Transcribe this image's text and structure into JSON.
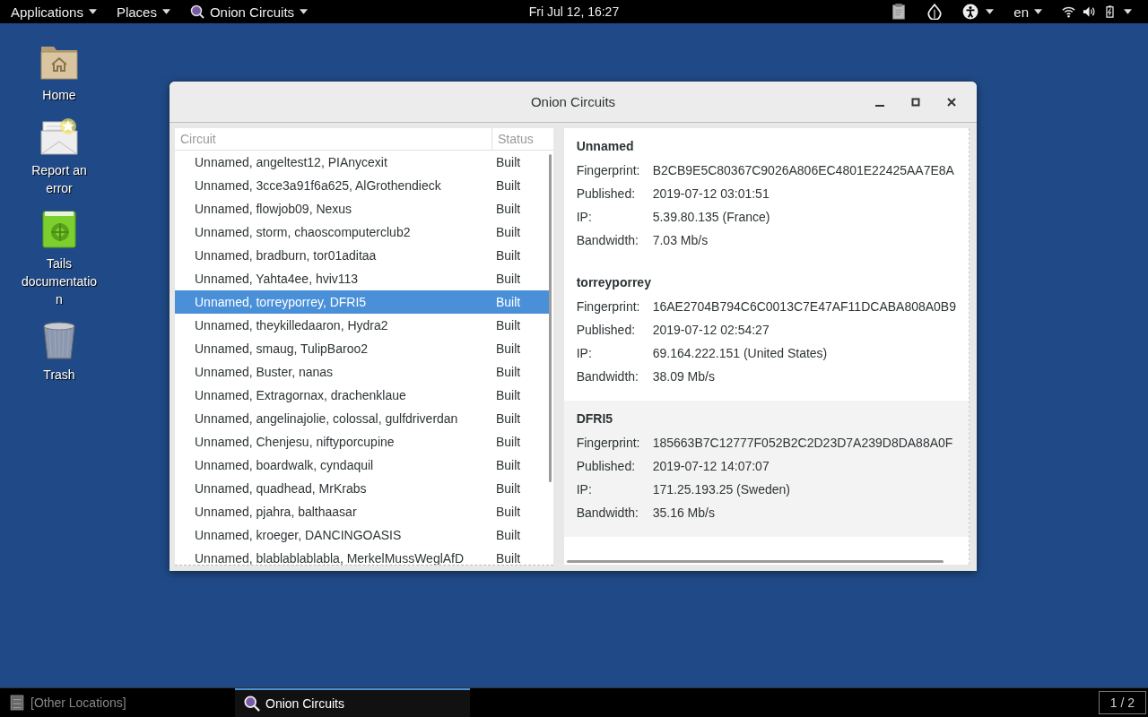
{
  "top_bar": {
    "menus": [
      {
        "label": "Applications",
        "kind": "menu"
      },
      {
        "label": "Places",
        "kind": "menu"
      },
      {
        "label": "Onion Circuits",
        "kind": "app"
      }
    ],
    "clock": "Fri Jul 12, 16:27",
    "language": "en"
  },
  "desktop_icons": [
    {
      "label": "Home",
      "kind": "home"
    },
    {
      "label": "Report an error",
      "kind": "mail"
    },
    {
      "label": "Tails documentation",
      "kind": "book"
    },
    {
      "label": "Trash",
      "kind": "trash"
    }
  ],
  "window": {
    "title": "Onion Circuits",
    "columns": [
      "Circuit",
      "Status"
    ],
    "rows": [
      {
        "circuit": "Unnamed, angeltest12, PIAnycexit",
        "status": "Built",
        "selected": false
      },
      {
        "circuit": "Unnamed, 3cce3a91f6a625, AlGrothendieck",
        "status": "Built",
        "selected": false
      },
      {
        "circuit": "Unnamed, flowjob09, Nexus",
        "status": "Built",
        "selected": false
      },
      {
        "circuit": "Unnamed, storm, chaoscomputerclub2",
        "status": "Built",
        "selected": false
      },
      {
        "circuit": "Unnamed, bradburn, tor01aditaa",
        "status": "Built",
        "selected": false
      },
      {
        "circuit": "Unnamed, Yahta4ee, hviv113",
        "status": "Built",
        "selected": false
      },
      {
        "circuit": "Unnamed, torreyporrey, DFRI5",
        "status": "Built",
        "selected": true
      },
      {
        "circuit": "Unnamed, theykilledaaron, Hydra2",
        "status": "Built",
        "selected": false
      },
      {
        "circuit": "Unnamed, smaug, TulipBaroo2",
        "status": "Built",
        "selected": false
      },
      {
        "circuit": "Unnamed, Buster, nanas",
        "status": "Built",
        "selected": false
      },
      {
        "circuit": "Unnamed, Extragornax, drachenklaue",
        "status": "Built",
        "selected": false
      },
      {
        "circuit": "Unnamed, angelinajolie, colossal, gulfdriverdan",
        "status": "Built",
        "selected": false
      },
      {
        "circuit": "Unnamed, Chenjesu, niftyporcupine",
        "status": "Built",
        "selected": false
      },
      {
        "circuit": "Unnamed, boardwalk, cyndaquil",
        "status": "Built",
        "selected": false
      },
      {
        "circuit": "Unnamed, quadhead, MrKrabs",
        "status": "Built",
        "selected": false
      },
      {
        "circuit": "Unnamed, pjahra, balthaasar",
        "status": "Built",
        "selected": false
      },
      {
        "circuit": "Unnamed, kroeger, DANCINGOASIS",
        "status": "Built",
        "selected": false
      },
      {
        "circuit": "Unnamed, blablablablabla, MerkelMussWeglAfD",
        "status": "Built",
        "selected": false
      }
    ],
    "nodes": [
      {
        "name": "Unnamed",
        "highlighted": false,
        "fields": [
          {
            "label": "Fingerprint:",
            "value": "B2CB9E5C80367C9026A806EC4801E22425AA7E8A"
          },
          {
            "label": "Published:",
            "value": "2019-07-12 03:01:51"
          },
          {
            "label": "IP:",
            "value": "5.39.80.135 (France)"
          },
          {
            "label": "Bandwidth:",
            "value": "7.03 Mb/s"
          }
        ]
      },
      {
        "name": "torreyporrey",
        "highlighted": false,
        "fields": [
          {
            "label": "Fingerprint:",
            "value": "16AE2704B794C6C0013C7E47AF11DCABA808A0B9"
          },
          {
            "label": "Published:",
            "value": "2019-07-12 02:54:27"
          },
          {
            "label": "IP:",
            "value": "69.164.222.151 (United States)"
          },
          {
            "label": "Bandwidth:",
            "value": "38.09 Mb/s"
          }
        ]
      },
      {
        "name": "DFRI5",
        "highlighted": true,
        "fields": [
          {
            "label": "Fingerprint:",
            "value": "185663B7C12777F052B2C2D23D7A239D8DA88A0F"
          },
          {
            "label": "Published:",
            "value": "2019-07-12 14:07:07"
          },
          {
            "label": "IP:",
            "value": "171.25.193.25 (Sweden)"
          },
          {
            "label": "Bandwidth:",
            "value": "35.16 Mb/s"
          }
        ]
      }
    ]
  },
  "taskbar": {
    "items": [
      {
        "label": "[Other Locations]",
        "kind": "files",
        "active": false
      },
      {
        "label": "Onion Circuits",
        "kind": "onion",
        "active": true
      }
    ],
    "workspace": "1 / 2"
  }
}
